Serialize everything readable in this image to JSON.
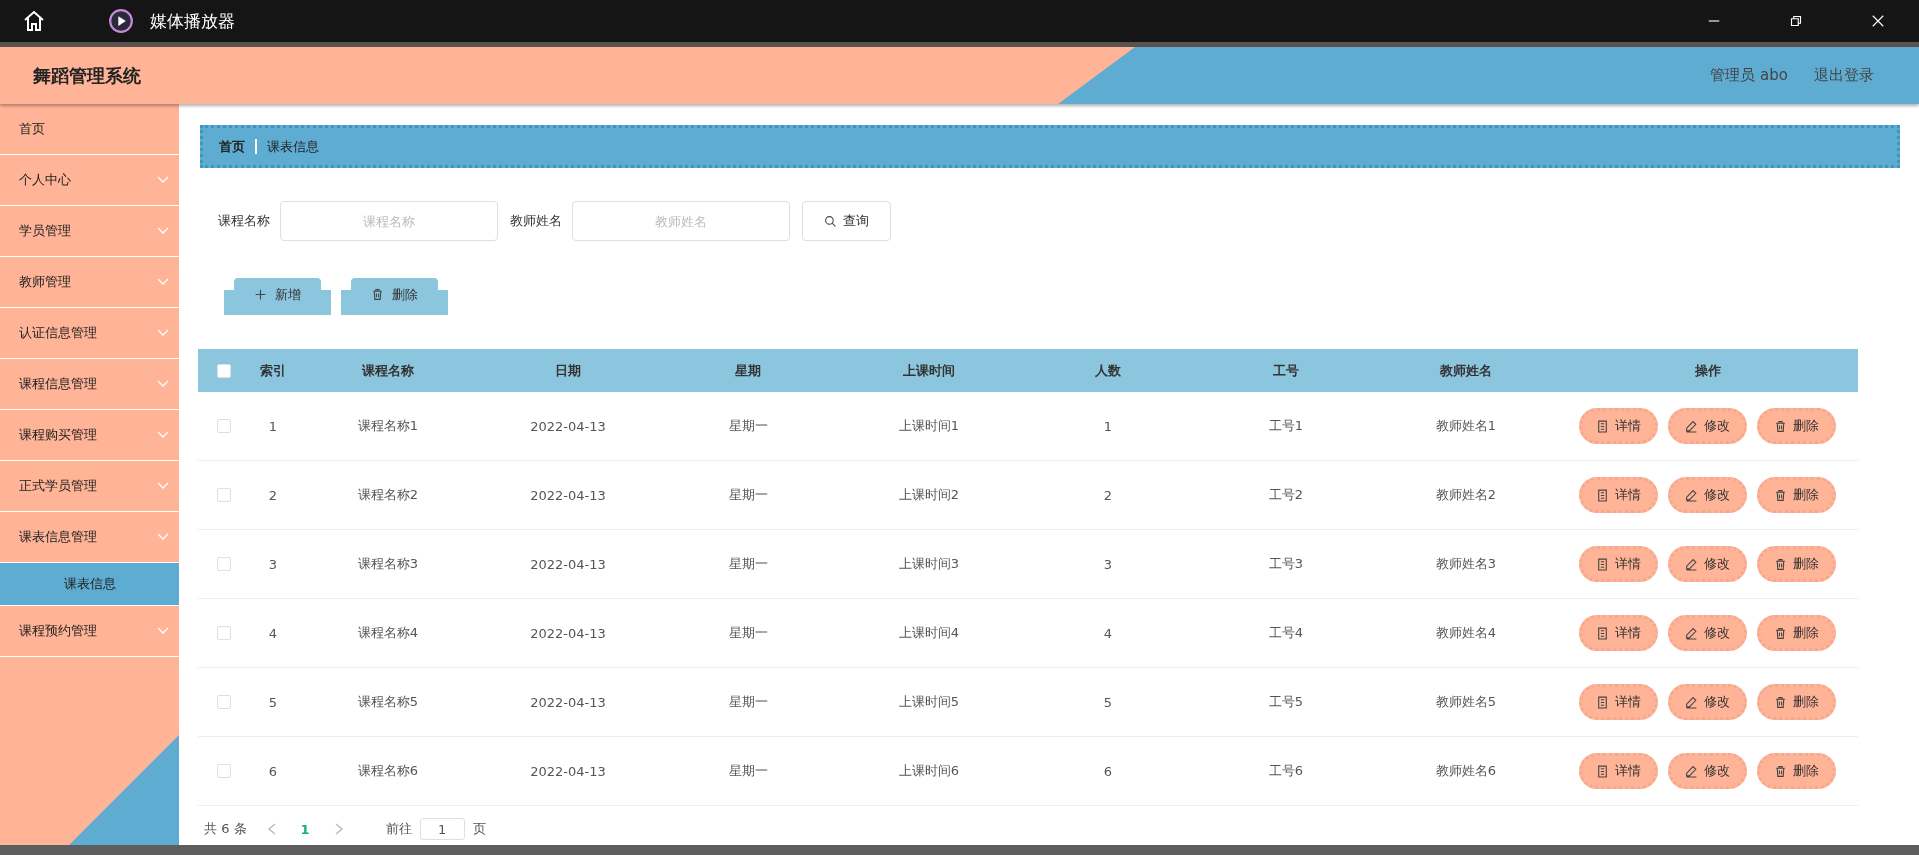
{
  "window": {
    "title": "媒体播放器"
  },
  "header": {
    "title": "舞蹈管理系统",
    "user": "管理员 abo",
    "logout": "退出登录"
  },
  "sidebar": {
    "items": [
      {
        "label": "首页",
        "kind": "link"
      },
      {
        "label": "个人中心",
        "kind": "menu"
      },
      {
        "label": "学员管理",
        "kind": "menu"
      },
      {
        "label": "教师管理",
        "kind": "menu"
      },
      {
        "label": "认证信息管理",
        "kind": "menu"
      },
      {
        "label": "课程信息管理",
        "kind": "menu"
      },
      {
        "label": "课程购买管理",
        "kind": "menu"
      },
      {
        "label": "正式学员管理",
        "kind": "menu"
      },
      {
        "label": "课表信息管理",
        "kind": "menu",
        "children": [
          {
            "label": "课表信息",
            "selected": true
          }
        ]
      },
      {
        "label": "课程预约管理",
        "kind": "menu"
      }
    ]
  },
  "breadcrumb": [
    "首页",
    "课表信息"
  ],
  "search": {
    "fields": [
      {
        "label": "课程名称",
        "placeholder": "课程名称"
      },
      {
        "label": "教师姓名",
        "placeholder": "教师姓名"
      }
    ],
    "button": "查询"
  },
  "toolbar": [
    {
      "label": "新增",
      "kind": "add"
    },
    {
      "label": "删除",
      "kind": "delete"
    }
  ],
  "table": {
    "header_checked": false,
    "columns": [
      "索引",
      "课程名称",
      "日期",
      "星期",
      "上课时间",
      "人数",
      "工号",
      "教师姓名",
      "操作"
    ],
    "rows": [
      {
        "checked": false,
        "cells": [
          "1",
          "课程名称1",
          "2022-04-13",
          "星期一",
          "上课时间1",
          "1",
          "工号1",
          "教师姓名1"
        ],
        "actions": [
          {
            "label": "详情",
            "kind": "detail"
          },
          {
            "label": "修改",
            "kind": "edit"
          },
          {
            "label": "删除",
            "kind": "delete"
          }
        ]
      },
      {
        "checked": false,
        "cells": [
          "2",
          "课程名称2",
          "2022-04-13",
          "星期一",
          "上课时间2",
          "2",
          "工号2",
          "教师姓名2"
        ],
        "actions": [
          {
            "label": "详情",
            "kind": "detail"
          },
          {
            "label": "修改",
            "kind": "edit"
          },
          {
            "label": "删除",
            "kind": "delete"
          }
        ]
      },
      {
        "checked": false,
        "cells": [
          "3",
          "课程名称3",
          "2022-04-13",
          "星期一",
          "上课时间3",
          "3",
          "工号3",
          "教师姓名3"
        ],
        "actions": [
          {
            "label": "详情",
            "kind": "detail"
          },
          {
            "label": "修改",
            "kind": "edit"
          },
          {
            "label": "删除",
            "kind": "delete"
          }
        ]
      },
      {
        "checked": false,
        "cells": [
          "4",
          "课程名称4",
          "2022-04-13",
          "星期一",
          "上课时间4",
          "4",
          "工号4",
          "教师姓名4"
        ],
        "actions": [
          {
            "label": "详情",
            "kind": "detail"
          },
          {
            "label": "修改",
            "kind": "edit"
          },
          {
            "label": "删除",
            "kind": "delete"
          }
        ]
      },
      {
        "checked": false,
        "cells": [
          "5",
          "课程名称5",
          "2022-04-13",
          "星期一",
          "上课时间5",
          "5",
          "工号5",
          "教师姓名5"
        ],
        "actions": [
          {
            "label": "详情",
            "kind": "detail"
          },
          {
            "label": "修改",
            "kind": "edit"
          },
          {
            "label": "删除",
            "kind": "delete"
          }
        ]
      },
      {
        "checked": false,
        "cells": [
          "6",
          "课程名称6",
          "2022-04-13",
          "星期一",
          "上课时间6",
          "6",
          "工号6",
          "教师姓名6"
        ],
        "actions": [
          {
            "label": "详情",
            "kind": "detail"
          },
          {
            "label": "修改",
            "kind": "edit"
          },
          {
            "label": "删除",
            "kind": "delete"
          }
        ]
      }
    ]
  },
  "pagination": {
    "total": "共 6 条",
    "pages": [
      {
        "label": "1",
        "selected": true
      }
    ],
    "goto": "前往",
    "page_value": "1",
    "page_unit": "页"
  }
}
